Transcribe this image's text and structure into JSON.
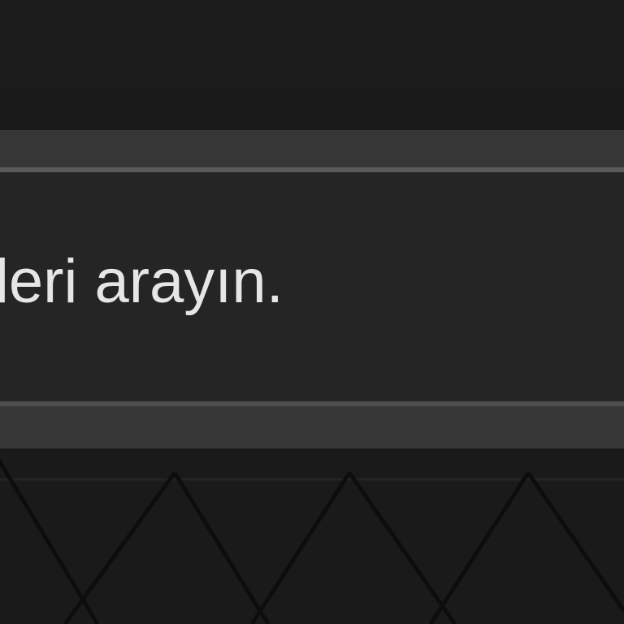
{
  "hint": {
    "text": "leri arayın."
  },
  "colors": {
    "background": "#1b1b1b",
    "panel": "#252525",
    "panel_border": "#363636",
    "text": "#e6e6e6",
    "pattern_line": "#0d0d0d"
  }
}
